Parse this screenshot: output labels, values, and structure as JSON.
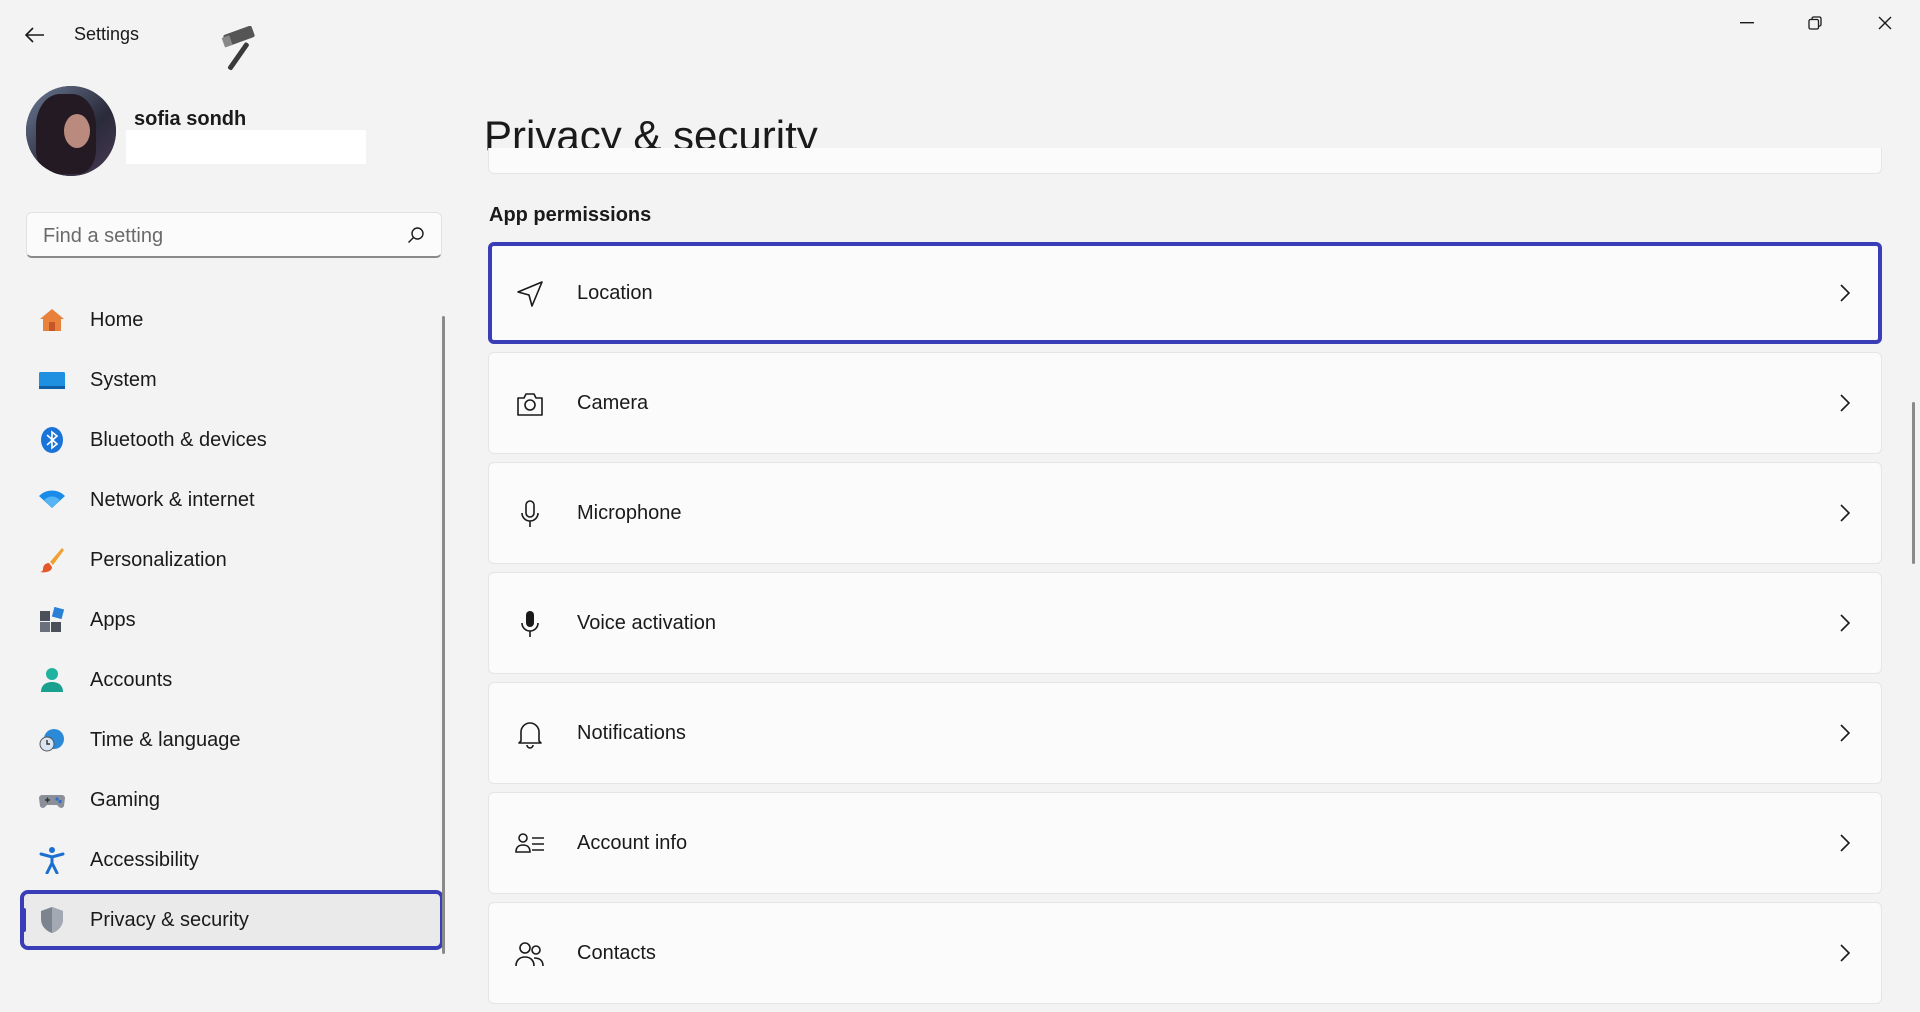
{
  "window": {
    "title": "Settings",
    "controls": [
      "minimize-icon",
      "restore-icon",
      "close-icon"
    ]
  },
  "profile": {
    "name": "sofia sondh",
    "email": ""
  },
  "search": {
    "placeholder": "Find a setting",
    "value": ""
  },
  "sidebar": {
    "items": [
      {
        "label": "Home",
        "icon": "home-icon",
        "active": false
      },
      {
        "label": "System",
        "icon": "system-icon",
        "active": false
      },
      {
        "label": "Bluetooth & devices",
        "icon": "bluetooth-icon",
        "active": false
      },
      {
        "label": "Network & internet",
        "icon": "wifi-icon",
        "active": false
      },
      {
        "label": "Personalization",
        "icon": "brush-icon",
        "active": false
      },
      {
        "label": "Apps",
        "icon": "apps-icon",
        "active": false
      },
      {
        "label": "Accounts",
        "icon": "accounts-icon",
        "active": false
      },
      {
        "label": "Time & language",
        "icon": "time-language-icon",
        "active": false
      },
      {
        "label": "Gaming",
        "icon": "gamepad-icon",
        "active": false
      },
      {
        "label": "Accessibility",
        "icon": "accessibility-icon",
        "active": false
      },
      {
        "label": "Privacy & security",
        "icon": "shield-icon",
        "active": true
      }
    ]
  },
  "main": {
    "title": "Privacy & security",
    "section": "App permissions",
    "items": [
      {
        "label": "Location",
        "icon": "location-icon",
        "highlighted": true
      },
      {
        "label": "Camera",
        "icon": "camera-icon",
        "highlighted": false
      },
      {
        "label": "Microphone",
        "icon": "microphone-icon",
        "highlighted": false
      },
      {
        "label": "Voice activation",
        "icon": "voice-activation-icon",
        "highlighted": false
      },
      {
        "label": "Notifications",
        "icon": "bell-icon",
        "highlighted": false
      },
      {
        "label": "Account info",
        "icon": "account-info-icon",
        "highlighted": false
      },
      {
        "label": "Contacts",
        "icon": "contacts-icon",
        "highlighted": false
      }
    ]
  },
  "colors": {
    "accent": "#3a3db8",
    "background": "#f3f3f3",
    "card": "#fbfbfb"
  }
}
